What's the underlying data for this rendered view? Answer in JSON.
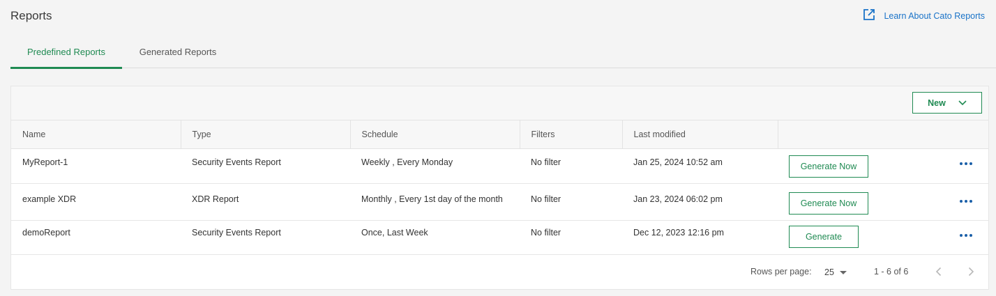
{
  "header": {
    "title": "Reports",
    "learn_link": "Learn About Cato Reports"
  },
  "tabs": [
    {
      "label": "Predefined Reports",
      "active": true
    },
    {
      "label": "Generated Reports",
      "active": false
    }
  ],
  "toolbar": {
    "new_label": "New"
  },
  "table": {
    "columns": [
      "Name",
      "Type",
      "Schedule",
      "Filters",
      "Last modified",
      ""
    ],
    "rows": [
      {
        "name": "MyReport-1",
        "type": "Security Events Report",
        "schedule": "Weekly , Every Monday",
        "filters": "No filter",
        "modified": "Jan 25, 2024 10:52 am",
        "action": "Generate Now"
      },
      {
        "name": "example XDR",
        "type": "XDR Report",
        "schedule": "Monthly , Every 1st day of the month",
        "filters": "No filter",
        "modified": "Jan 23, 2024 06:02 pm",
        "action": "Generate Now"
      },
      {
        "name": "demoReport",
        "type": "Security Events Report",
        "schedule": "Once, Last Week",
        "filters": "No filter",
        "modified": "Dec 12, 2023 12:16 pm",
        "action": "Generate"
      }
    ]
  },
  "pagination": {
    "rows_per_page_label": "Rows per page:",
    "rows_per_page": "25",
    "range": "1 - 6 of 6"
  },
  "colors": {
    "accent_green": "#1f8a52",
    "link_blue": "#1a73c8"
  },
  "icons": [
    "external-link-icon",
    "chevron-down-icon",
    "more-horizontal-icon",
    "chevron-left-icon",
    "chevron-right-icon"
  ]
}
